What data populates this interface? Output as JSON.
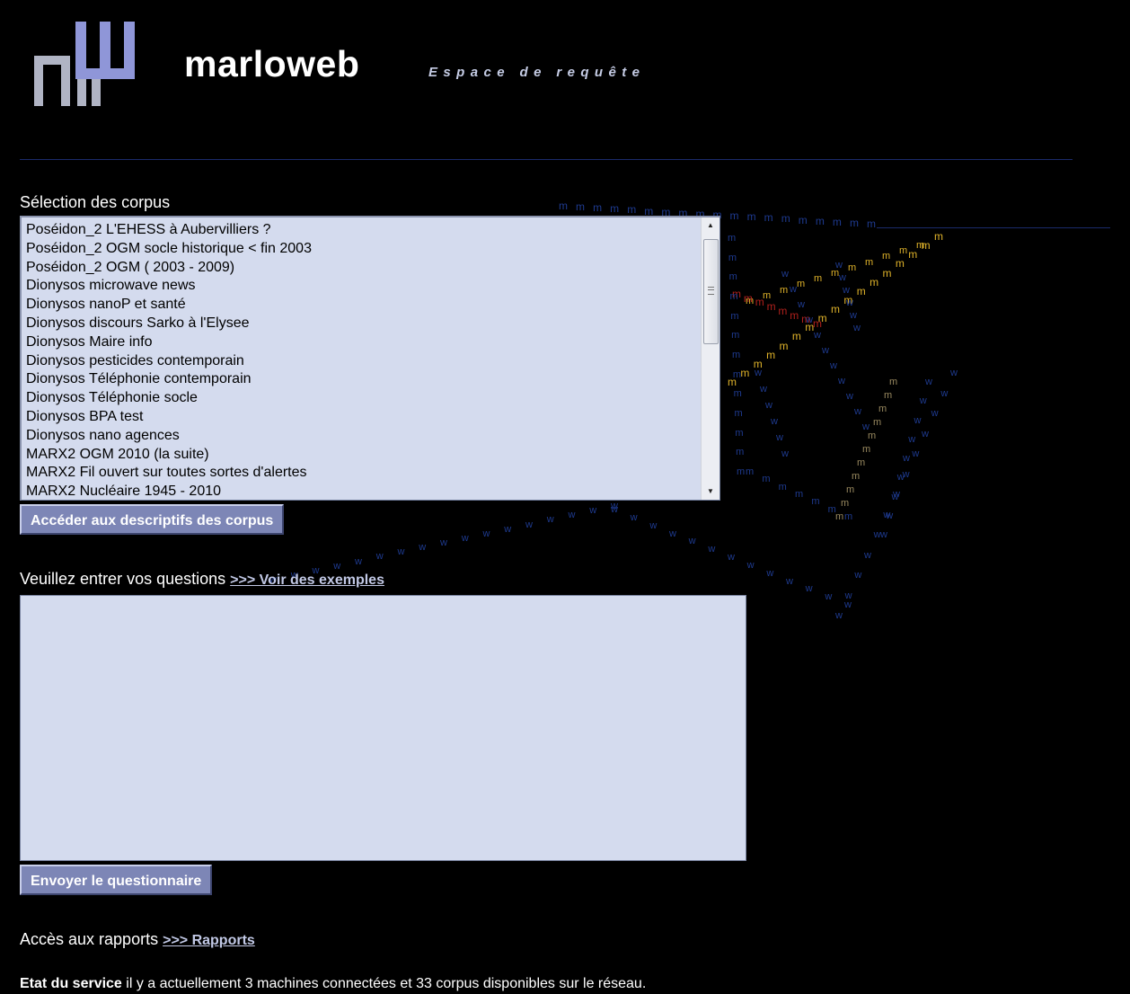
{
  "header": {
    "brand": "marloweb",
    "tagline": "Espace de requête"
  },
  "corpus_section": {
    "label": "Sélection des corpus",
    "items": [
      "Poséidon_2 L'EHESS à Aubervilliers ?",
      "Poséidon_2 OGM socle historique < fin 2003",
      "Poséidon_2 OGM ( 2003 - 2009)",
      "Dionysos microwave news",
      "Dionysos nanoP et santé",
      "Dionysos discours Sarko à l'Elysee",
      "Dionysos Maire info",
      "Dionysos pesticides contemporain",
      "Dionysos Téléphonie contemporain",
      "Dionysos Téléphonie socle",
      "Dionysos BPA test",
      "Dionysos nano agences",
      "MARX2 OGM 2010 (la suite)",
      "MARX2 Fil ouvert sur toutes sortes d'alertes",
      "MARX2 Nucléaire 1945 - 2010"
    ],
    "describe_button": "Accéder aux descriptifs des corpus"
  },
  "questions_section": {
    "label": "Veuillez entrer vos questions",
    "examples_link": ">>> Voir des exemples",
    "textarea_value": "",
    "submit_button": "Envoyer le questionnaire"
  },
  "reports_section": {
    "label": "Accès aux rapports",
    "reports_link": ">>> Rapports"
  },
  "service_status": {
    "label": "Etat du service",
    "text": "il y a actuellement 3 machines connectées et 33 corpus disponibles sur le réseau."
  },
  "colors": {
    "background": "#000000",
    "field_bg": "#d4dbee",
    "button_bg": "#7d86b6",
    "glyph_blue": "#1e3a8f",
    "glyph_gold": "#e0b32a",
    "glyph_red": "#b0201c"
  },
  "icons": {
    "logo": "marloweb-logo",
    "scroll_up": "arrow-up-icon",
    "scroll_down": "arrow-down-icon"
  }
}
